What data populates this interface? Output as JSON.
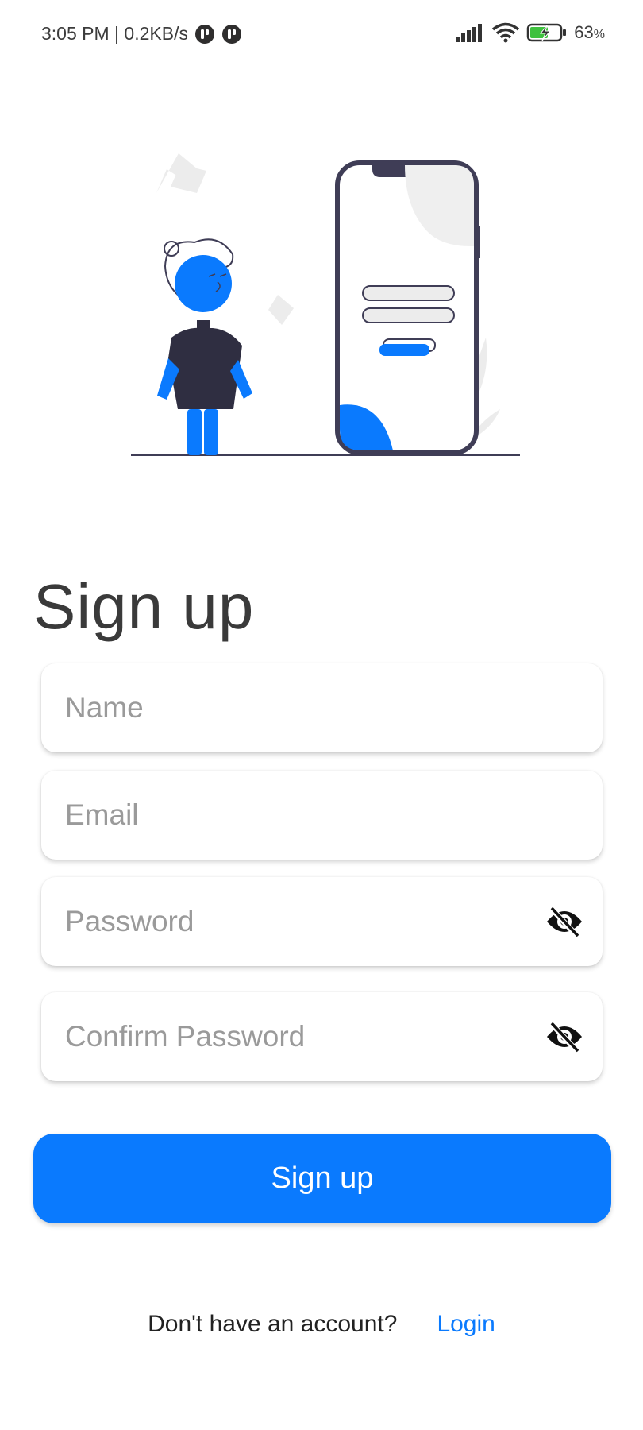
{
  "status_bar": {
    "time_speed": "3:05 PM | 0.2KB/s",
    "battery": "63",
    "battery_unit": "%"
  },
  "page": {
    "title": "Sign up"
  },
  "form": {
    "name_placeholder": "Name",
    "email_placeholder": "Email",
    "password_placeholder": "Password",
    "confirm_placeholder": "Confirm Password",
    "submit_label": "Sign up"
  },
  "footer": {
    "prompt": "Don't have an account?",
    "link": "Login"
  },
  "colors": {
    "accent": "#0a7afe",
    "dark": "#2f2e41",
    "text": "#3a3a3a"
  },
  "icons": [
    "notification-icon",
    "signal-icon",
    "wifi-icon",
    "battery-charging-icon",
    "eye-off-icon"
  ]
}
